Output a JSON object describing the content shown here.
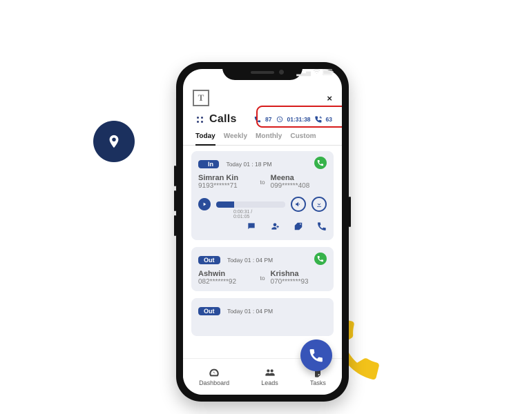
{
  "page": {
    "title": "Calls"
  },
  "stats": {
    "calls": "87",
    "duration": "01:31:38",
    "connected": "63"
  },
  "tabs": [
    {
      "label": "Today",
      "active": true
    },
    {
      "label": "Weekly",
      "active": false
    },
    {
      "label": "Monthly",
      "active": false
    },
    {
      "label": "Custom",
      "active": false
    }
  ],
  "cards": [
    {
      "dir": "In",
      "ts": "Today 01 : 18 PM",
      "from_name": "Simran Kin",
      "from_phone": "9193******71",
      "to_label": "to",
      "to_name": "Meena",
      "to_phone": "099******408",
      "time_label": "0:00:31 / 0:01:05",
      "has_player": true
    },
    {
      "dir": "Out",
      "ts": "Today 01 : 04 PM",
      "from_name": "Ashwin",
      "from_phone": "082*******92",
      "to_label": "to",
      "to_name": "Krishna",
      "to_phone": "070*******93",
      "has_player": false
    },
    {
      "dir": "Out",
      "ts": "Today 01 : 04 PM",
      "has_player": false
    }
  ],
  "nav": {
    "dashboard": "Dashboard",
    "leads": "Leads",
    "tasks": "Tasks"
  }
}
